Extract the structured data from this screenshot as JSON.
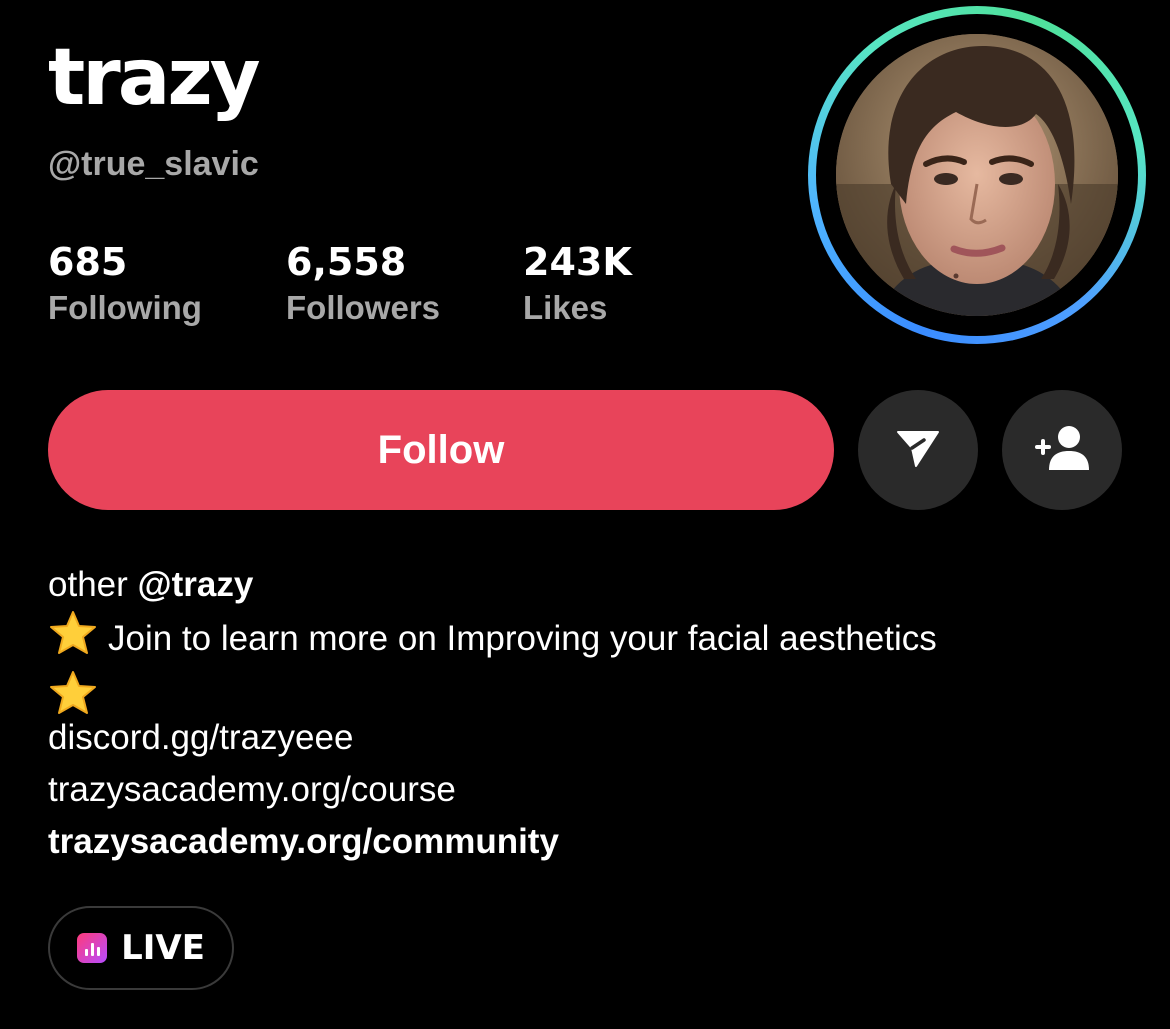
{
  "profile": {
    "display_name": "trazy",
    "handle": "@true_slavic"
  },
  "stats": [
    {
      "value": "685",
      "label": "Following"
    },
    {
      "value": "6,558",
      "label": "Followers"
    },
    {
      "value": "243K",
      "label": "Likes"
    }
  ],
  "actions": {
    "follow_label": "Follow",
    "follow_color": "#e8445a",
    "message_icon": "send-icon",
    "add_friend_icon": "add-user-icon"
  },
  "bio": {
    "line1_prefix": "other",
    "line1_mention": "@trazy",
    "line2": "Join to learn more on Improving your facial aesthetics",
    "star_icon": "star-icon"
  },
  "links": [
    "discord.gg/trazyeee",
    "trazysacademy.org/course",
    "trazysacademy.org/community"
  ],
  "live": {
    "label": "LIVE",
    "icon": "live-icon",
    "icon_gradient": [
      "#ff3b7a",
      "#b64cff"
    ]
  },
  "avatar": {
    "ring_colors": [
      "#3a8cff",
      "#57e6c4"
    ]
  }
}
